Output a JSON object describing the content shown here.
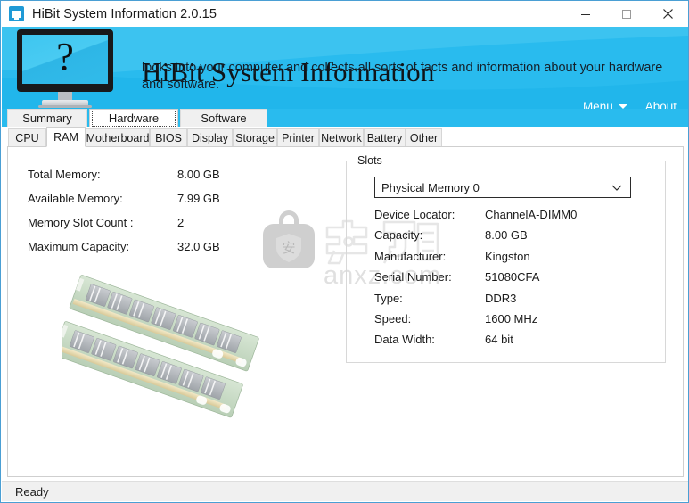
{
  "window": {
    "title": "HiBit System Information 2.0.15",
    "icon": "app-monitor-icon",
    "minimize_label": "—",
    "maximize_label": "☐",
    "close_label": "✕",
    "border_color": "#4a9fd4"
  },
  "banner": {
    "brand_title": "HiBit System Information",
    "brand_subtitle": "looks into your computer and collects all sorts of facts and information about your hardware and software.",
    "logo_glyph": "?",
    "background_color": "#29bbee",
    "menu_label": "Menu",
    "about_label": "About"
  },
  "main_tabs": [
    {
      "label": "Summary",
      "selected": false
    },
    {
      "label": "Hardware",
      "selected": true
    },
    {
      "label": "Software",
      "selected": false
    }
  ],
  "sub_tabs": [
    {
      "label": "CPU",
      "selected": false
    },
    {
      "label": "RAM",
      "selected": true
    },
    {
      "label": "Motherboard",
      "selected": false
    },
    {
      "label": "BIOS",
      "selected": false
    },
    {
      "label": "Display",
      "selected": false
    },
    {
      "label": "Storage",
      "selected": false
    },
    {
      "label": "Printer",
      "selected": false
    },
    {
      "label": "Network",
      "selected": false
    },
    {
      "label": "Battery",
      "selected": false
    },
    {
      "label": "Other",
      "selected": false
    }
  ],
  "memory_summary": [
    {
      "label": "Total Memory:",
      "value": "8.00  GB"
    },
    {
      "label": "Available Memory:",
      "value": "7.99  GB"
    },
    {
      "label": "Memory Slot Count :",
      "value": "2"
    },
    {
      "label": "Maximum Capacity:",
      "value": "32.0  GB"
    }
  ],
  "slots": {
    "group_title": "Slots",
    "selected_slot": "Physical Memory 0",
    "details": [
      {
        "label": "Device Locator:",
        "value": "ChannelA-DIMM0"
      },
      {
        "label": "Capacity:",
        "value": "8.00  GB"
      },
      {
        "label": "Manufacturer:",
        "value": "Kingston"
      },
      {
        "label": "Serial Number:",
        "value": "51080CFA"
      },
      {
        "label": "Type:",
        "value": "DDR3"
      },
      {
        "label": "Speed:",
        "value": "1600 MHz"
      },
      {
        "label": "Data Width:",
        "value": "64 bit"
      }
    ]
  },
  "watermark": {
    "text": "anxz.com",
    "glyph": "安"
  },
  "statusbar": {
    "text": "Ready"
  }
}
